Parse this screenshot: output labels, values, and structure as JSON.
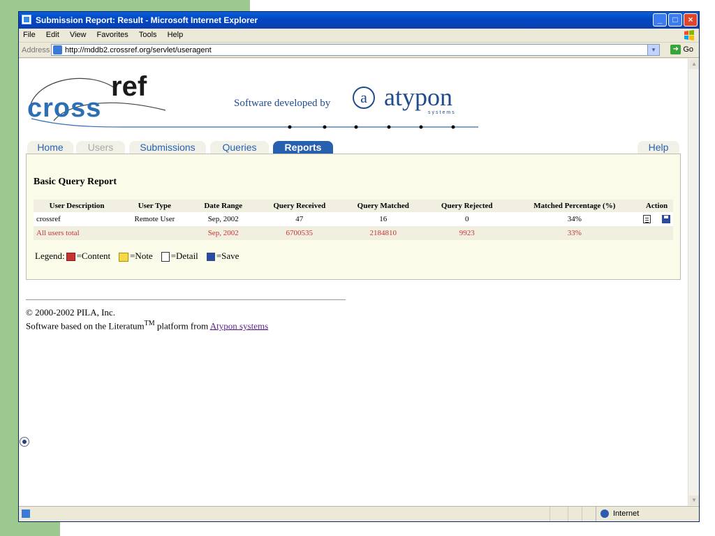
{
  "window": {
    "title": "Submission Report: Result - Microsoft Internet Explorer",
    "min_label": "_",
    "max_label": "□",
    "close_label": "×"
  },
  "menu": [
    "File",
    "Edit",
    "View",
    "Favorites",
    "Tools",
    "Help"
  ],
  "address": {
    "label": "Address",
    "url": "http://mddb2.crossref.org/servlet/useragent",
    "go_label": "Go",
    "dropdown_glyph": "▾"
  },
  "brand": {
    "cross": "cross",
    "ref": "ref",
    "developed_by": "Software developed by",
    "atypon": "atypon",
    "atypon_sub": "systems",
    "atypon_mark": "a"
  },
  "tabs": [
    {
      "label": "Home",
      "state": "normal"
    },
    {
      "label": "Users",
      "state": "disabled"
    },
    {
      "label": "Submissions",
      "state": "normal"
    },
    {
      "label": "Queries",
      "state": "normal"
    },
    {
      "label": "Reports",
      "state": "active"
    },
    {
      "label": "Help",
      "state": "normal"
    }
  ],
  "report": {
    "title": "Basic Query Report",
    "columns": [
      "User Description",
      "User Type",
      "Date Range",
      "Query Received",
      "Query Matched",
      "Query Rejected",
      "Matched Percentage (%)",
      "Action"
    ],
    "rows": [
      {
        "description": "crossref",
        "user_type": "Remote User",
        "date_range": "Sep, 2002",
        "received": "47",
        "matched": "16",
        "rejected": "0",
        "percentage": "34%"
      },
      {
        "description": "All users total",
        "user_type": "",
        "date_range": "Sep, 2002",
        "received": "6700535",
        "matched": "2184810",
        "rejected": "9923",
        "percentage": "33%"
      }
    ],
    "legend": {
      "label": "Legend:",
      "content": "=Content",
      "note": "=Note",
      "detail": "=Detail",
      "save": "=Save"
    }
  },
  "footer": {
    "copyright": "© 2000-2002 PILA, Inc.",
    "software_prefix": "Software based on the Literatum",
    "tm": "TM",
    "software_mid": " platform from ",
    "link_text": "Atypon systems"
  },
  "status": {
    "zone": "Internet"
  },
  "colors": {
    "tab_blue": "#2860b0",
    "panel_bg": "#fbfbe9",
    "total_red": "#c83434",
    "desktop_green": "#9cc98f"
  }
}
